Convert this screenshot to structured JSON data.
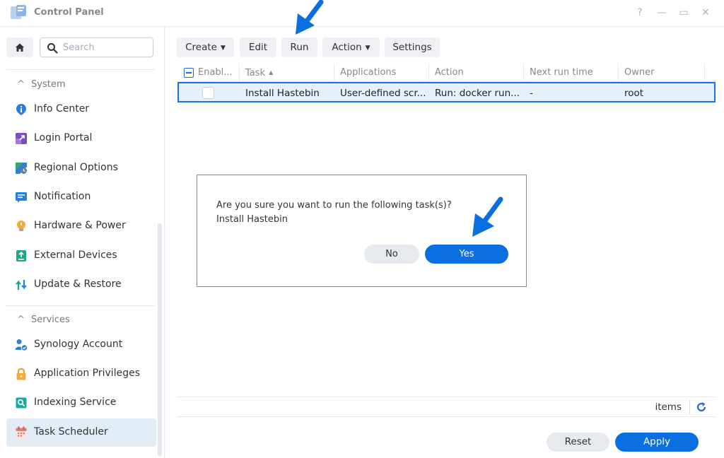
{
  "window": {
    "title": "Control Panel",
    "controls": {
      "help": "?",
      "minimize": "—",
      "maximize": "▭",
      "close": "✕"
    }
  },
  "sidebar": {
    "search": {
      "placeholder": "Search"
    },
    "sections": [
      {
        "label": "System",
        "items": [
          {
            "label": "Info Center",
            "icon": "info-icon"
          },
          {
            "label": "Login Portal",
            "icon": "login-portal-icon"
          },
          {
            "label": "Regional Options",
            "icon": "regional-options-icon"
          },
          {
            "label": "Notification",
            "icon": "notification-icon"
          },
          {
            "label": "Hardware & Power",
            "icon": "hardware-power-icon"
          },
          {
            "label": "External Devices",
            "icon": "external-devices-icon"
          },
          {
            "label": "Update & Restore",
            "icon": "update-restore-icon"
          }
        ]
      },
      {
        "label": "Services",
        "items": [
          {
            "label": "Synology Account",
            "icon": "synology-account-icon"
          },
          {
            "label": "Application Privileges",
            "icon": "lock-icon"
          },
          {
            "label": "Indexing Service",
            "icon": "indexing-service-icon"
          },
          {
            "label": "Task Scheduler",
            "icon": "calendar-icon",
            "active": true
          }
        ]
      }
    ]
  },
  "toolbar": {
    "create": "Create",
    "edit": "Edit",
    "run": "Run",
    "action": "Action",
    "settings": "Settings"
  },
  "grid": {
    "columns": [
      "Enabl...",
      "Task",
      "Applications",
      "Action",
      "Next run time",
      "Owner"
    ],
    "rows": [
      {
        "enabled": false,
        "task": "Install Hastebin",
        "applications": "User-defined scr...",
        "action": "Run: docker run...",
        "next_run": "-",
        "owner": "root"
      }
    ]
  },
  "footer": {
    "items_label": "items",
    "reset": "Reset",
    "apply": "Apply"
  },
  "dialog": {
    "message": "Are you sure you want to run the following task(s)?",
    "task": "Install Hastebin",
    "no": "No",
    "yes": "Yes"
  },
  "colors": {
    "primary": "#0a6fe0",
    "selection_border": "#1b73e0",
    "selection_bg": "#e6f0fb",
    "annotation_arrow": "#0a6fe0"
  }
}
